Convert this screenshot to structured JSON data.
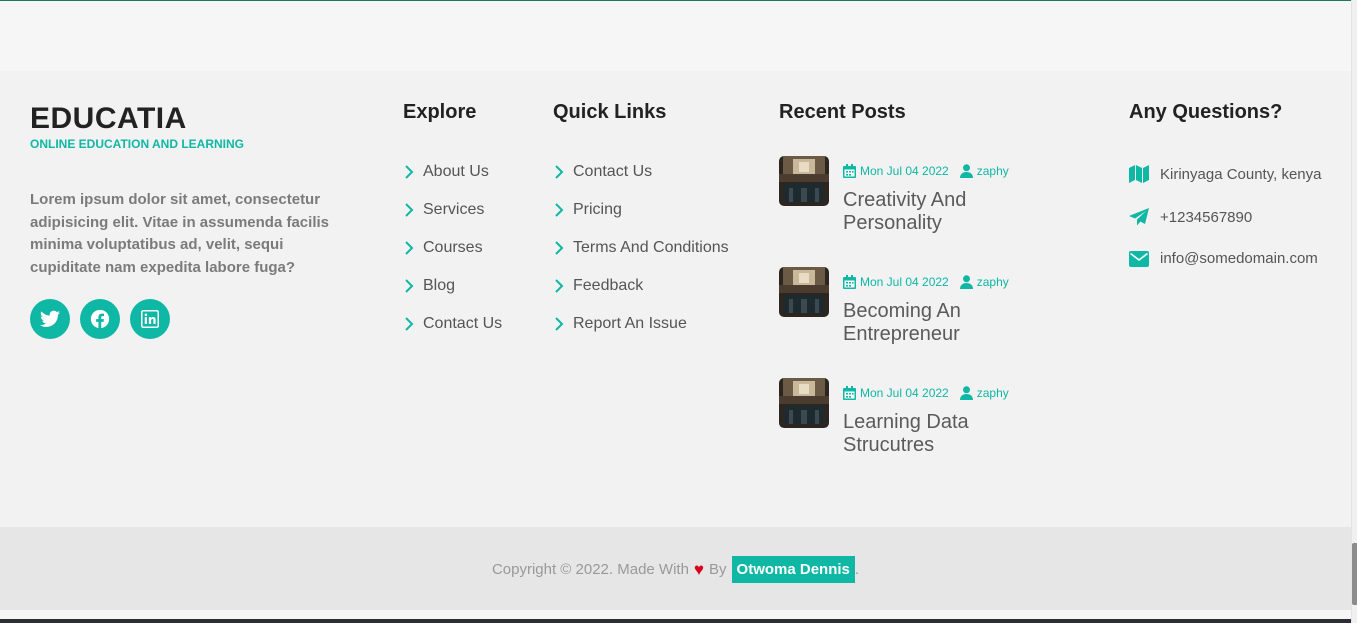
{
  "brand": {
    "title": "EDUCATIA",
    "subtitle": "ONLINE EDUCATION AND LEARNING",
    "description": "Lorem ipsum dolor sit amet, consectetur adipisicing elit. Vitae in assumenda facilis minima voluptatibus ad, velit, sequi cupiditate nam expedita labore fuga?"
  },
  "socials": [
    {
      "icon": "twitter-icon"
    },
    {
      "icon": "facebook-icon"
    },
    {
      "icon": "linkedin-icon"
    }
  ],
  "explore": {
    "title": "Explore",
    "items": [
      "About Us",
      "Services",
      "Courses",
      "Blog",
      "Contact Us"
    ]
  },
  "quick_links": {
    "title": "Quick Links",
    "items": [
      "Contact Us",
      "Pricing",
      "Terms And Conditions",
      "Feedback",
      "Report An Issue"
    ]
  },
  "recent_posts": {
    "title": "Recent Posts",
    "posts": [
      {
        "date": "Mon Jul 04 2022",
        "author": "zaphy",
        "title": "Creativity And Personality"
      },
      {
        "date": "Mon Jul 04 2022",
        "author": "zaphy",
        "title": "Becoming An Entrepreneur"
      },
      {
        "date": "Mon Jul 04 2022",
        "author": "zaphy",
        "title": "Learning Data Strucutres"
      }
    ]
  },
  "questions": {
    "title": "Any Questions?",
    "address": "Kirinyaga County, kenya",
    "phone": "+1234567890",
    "email": "info@somedomain.com"
  },
  "footer": {
    "copyright_prefix": "Copyright © 2022. Made With",
    "heart": "♥",
    "by": "By",
    "author": "Otwoma Dennis",
    "suffix": "."
  },
  "colors": {
    "accent": "#0fb7a5",
    "heart": "#d9001b"
  }
}
